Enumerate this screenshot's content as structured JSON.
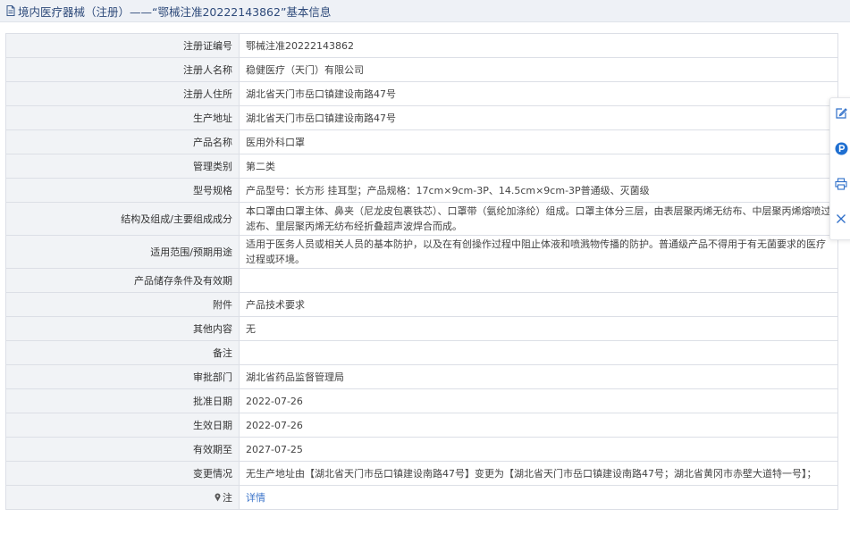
{
  "title": "境内医疗器械（注册）——“鄂械注准20222143862”基本信息",
  "rows": [
    {
      "label": "注册证编号",
      "value": "鄂械注准20222143862"
    },
    {
      "label": "注册人名称",
      "value": "稳健医疗（天门）有限公司"
    },
    {
      "label": "注册人住所",
      "value": "湖北省天门市岳口镇建设南路47号"
    },
    {
      "label": "生产地址",
      "value": "湖北省天门市岳口镇建设南路47号"
    },
    {
      "label": "产品名称",
      "value": "医用外科口罩"
    },
    {
      "label": "管理类别",
      "value": "第二类"
    },
    {
      "label": "型号规格",
      "value": "产品型号：长方形 挂耳型；产品规格：17cm×9cm-3P、14.5cm×9cm-3P普通级、灭菌级"
    },
    {
      "label": "结构及组成/主要组成成分",
      "value": "本口罩由口罩主体、鼻夹（尼龙皮包裹铁芯）、口罩带（氨纶加涤纶）组成。口罩主体分三层，由表层聚丙烯无纺布、中层聚丙烯熔喷过滤布、里层聚丙烯无纺布经折叠超声波焊合而成。"
    },
    {
      "label": "适用范围/预期用途",
      "value": "适用于医务人员或相关人员的基本防护，以及在有创操作过程中阻止体液和喷溅物传播的防护。普通级产品不得用于有无菌要求的医疗过程或环境。"
    },
    {
      "label": "产品储存条件及有效期",
      "value": ""
    },
    {
      "label": "附件",
      "value": "产品技术要求"
    },
    {
      "label": "其他内容",
      "value": "无"
    },
    {
      "label": "备注",
      "value": ""
    },
    {
      "label": "审批部门",
      "value": "湖北省药品监督管理局"
    },
    {
      "label": "批准日期",
      "value": "2022-07-26"
    },
    {
      "label": "生效日期",
      "value": "2022-07-26"
    },
    {
      "label": "有效期至",
      "value": "2027-07-25"
    },
    {
      "label": "变更情况",
      "value": "无生产地址由【湖北省天门市岳口镇建设南路47号】变更为【湖北省天门市岳口镇建设南路47号；湖北省黄冈市赤壁大道特一号】；"
    },
    {
      "label": "注",
      "value": "详情"
    }
  ],
  "icons": {
    "title": "document-icon",
    "note": "pin-icon",
    "floatbar": [
      "edit-icon",
      "parking-icon",
      "print-icon",
      "close-icon"
    ]
  },
  "colors": {
    "title_text": "#2e4a7a",
    "label_bg": "#f1f3f6",
    "link": "#3a73c9",
    "accent_blue": "#1f6fd1"
  }
}
